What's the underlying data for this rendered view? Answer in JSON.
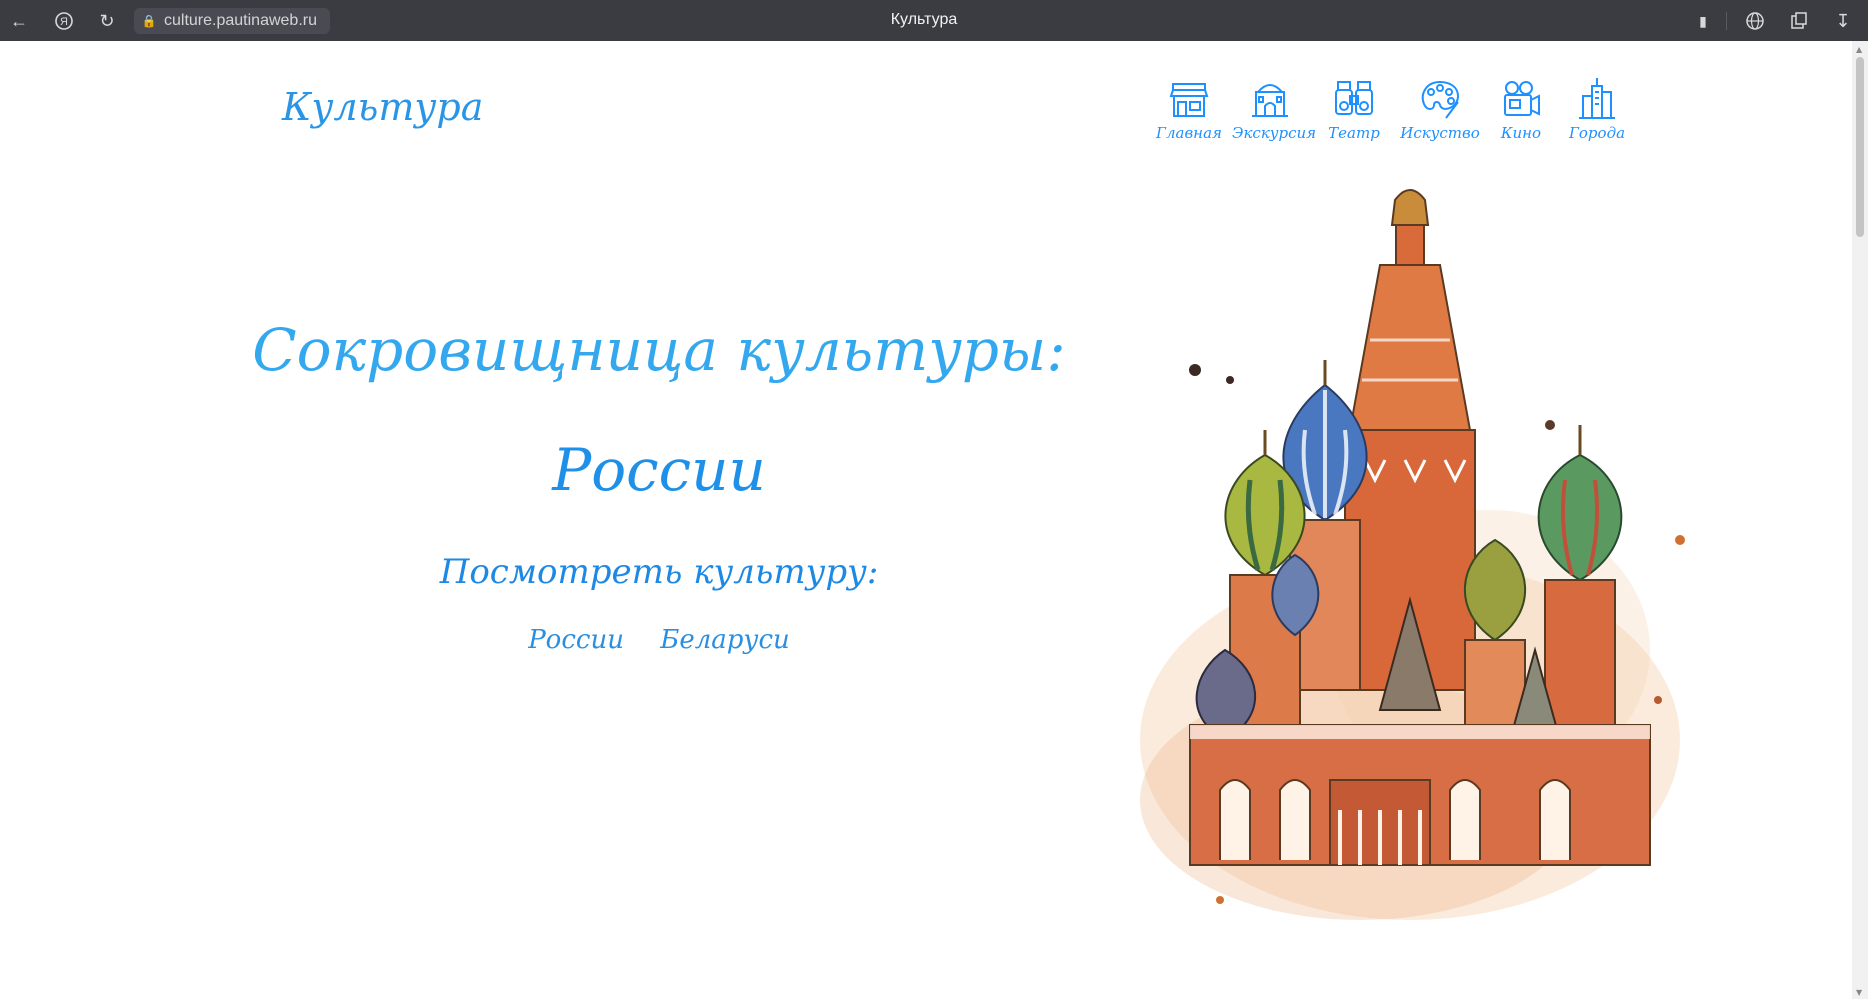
{
  "browser": {
    "url": "culture.pautinaweb.ru",
    "tab_title": "Культура"
  },
  "header": {
    "logo": "Культура",
    "nav": [
      {
        "label": "Главная",
        "icon": "shop-icon"
      },
      {
        "label": "Экскурсия",
        "icon": "museum-icon"
      },
      {
        "label": "Театр",
        "icon": "binoculars-icon"
      },
      {
        "label": "Искуство",
        "icon": "palette-icon"
      },
      {
        "label": "Кино",
        "icon": "movie-camera-icon"
      },
      {
        "label": "Города",
        "icon": "city-icon"
      }
    ]
  },
  "hero": {
    "title_line1": "Сокровищница культуры:",
    "title_line2": "России",
    "subtitle": "Посмотреть культуру:",
    "links": [
      "России",
      "Беларуси"
    ]
  },
  "colors": {
    "accent": "#1e90ff",
    "chrome_bg": "#3b3c42"
  }
}
